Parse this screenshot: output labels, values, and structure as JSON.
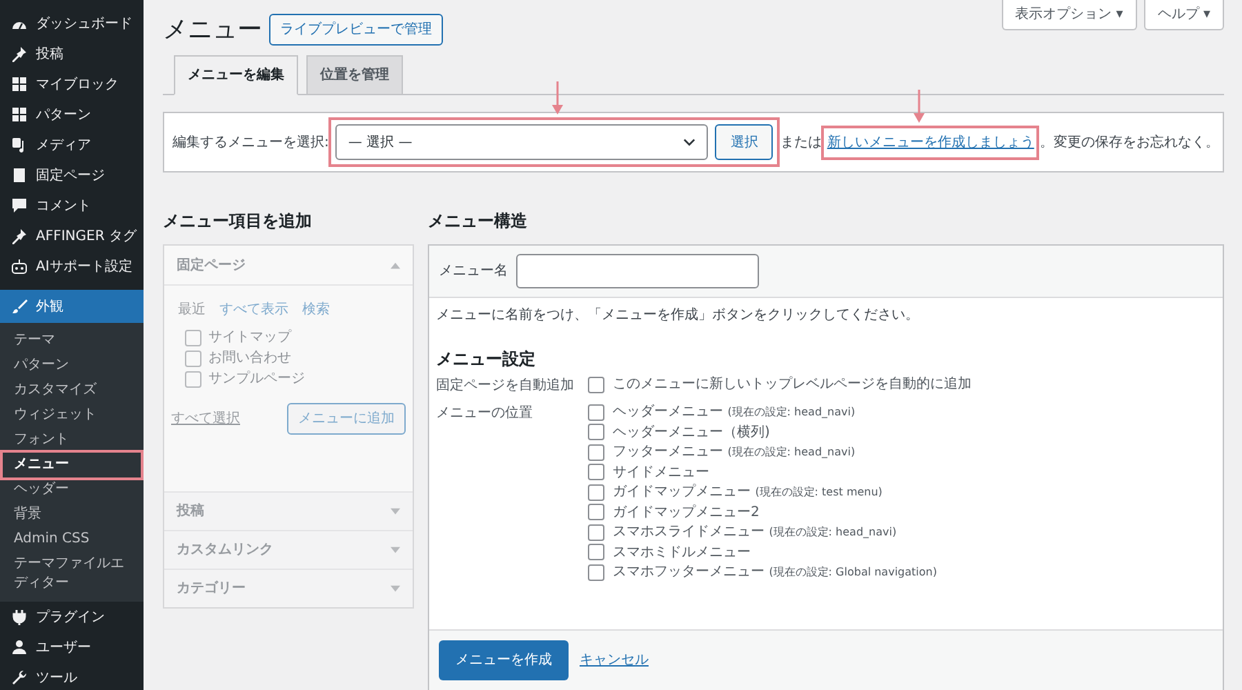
{
  "sidebar": {
    "items": [
      {
        "label": "ダッシュボード",
        "kind": "gauge",
        "current": false
      },
      {
        "label": "投稿",
        "kind": "pin",
        "current": false
      },
      {
        "label": "マイブロック",
        "kind": "grid",
        "current": false
      },
      {
        "label": "パターン",
        "kind": "grid",
        "current": false
      },
      {
        "label": "メディア",
        "kind": "media",
        "current": false
      },
      {
        "label": "固定ページ",
        "kind": "page",
        "current": false
      },
      {
        "label": "コメント",
        "kind": "comment",
        "current": false
      },
      {
        "label": "AFFINGER タグ",
        "kind": "pin",
        "current": false
      },
      {
        "label": "AIサポート設定",
        "kind": "robot",
        "current": false
      },
      {
        "label": "外観",
        "kind": "brush",
        "current": true,
        "children": [
          {
            "label": "テーマ",
            "selected": false,
            "highlighted": false
          },
          {
            "label": "パターン",
            "selected": false,
            "highlighted": false
          },
          {
            "label": "カスタマイズ",
            "selected": false,
            "highlighted": false
          },
          {
            "label": "ウィジェット",
            "selected": false,
            "highlighted": false
          },
          {
            "label": "フォント",
            "selected": false,
            "highlighted": false
          },
          {
            "label": "メニュー",
            "selected": true,
            "highlighted": true
          },
          {
            "label": "ヘッダー",
            "selected": false,
            "highlighted": false
          },
          {
            "label": "背景",
            "selected": false,
            "highlighted": false
          },
          {
            "label": "Admin CSS",
            "selected": false,
            "highlighted": false
          },
          {
            "label": "テーマファイルエディター",
            "selected": false,
            "highlighted": false
          }
        ]
      },
      {
        "label": "プラグイン",
        "kind": "plug",
        "current": false
      },
      {
        "label": "ユーザー",
        "kind": "user",
        "current": false
      },
      {
        "label": "ツール",
        "kind": "wrench",
        "current": false
      }
    ]
  },
  "header": {
    "title": "メニュー",
    "live_preview_button": "ライブプレビューで管理",
    "screen_options": "表示オプション ▾",
    "help": "ヘルプ ▾"
  },
  "tabs": [
    {
      "label": "メニューを編集",
      "selected": true
    },
    {
      "label": "位置を管理",
      "selected": false
    }
  ],
  "select_bar": {
    "label": "編集するメニューを選択:",
    "value": "— 選択 —",
    "button": "選択",
    "highlighted": true,
    "or_text": "または",
    "create_link": "新しいメニューを作成しましょう",
    "link_highlighted": true,
    "tail": "。変更の保存をお忘れなく。"
  },
  "add_items": {
    "heading": "メニュー項目を追加",
    "disabled": true,
    "sections": [
      {
        "title": "固定ページ",
        "expanded": true,
        "tabs": [
          {
            "label": "最近",
            "selected": true
          },
          {
            "label": "すべて表示",
            "selected": false
          },
          {
            "label": "検索",
            "selected": false
          }
        ],
        "pages": [
          {
            "label": "サイトマップ",
            "checked": false
          },
          {
            "label": "お問い合わせ",
            "checked": false
          },
          {
            "label": "サンプルページ",
            "checked": false
          }
        ],
        "select_all": "すべて選択",
        "add_button": "メニューに追加"
      },
      {
        "title": "投稿",
        "expanded": false
      },
      {
        "title": "カスタムリンク",
        "expanded": false
      },
      {
        "title": "カテゴリー",
        "expanded": false
      }
    ]
  },
  "structure": {
    "heading": "メニュー構造",
    "name_label": "メニュー名",
    "instruction": "メニューに名前をつけ、「メニューを作成」ボタンをクリックしてください。",
    "settings_heading": "メニュー設定",
    "auto_add": {
      "label": "固定ページを自動追加",
      "option": "このメニューに新しいトップレベルページを自動的に追加",
      "checked": false
    },
    "locations": {
      "label": "メニューの位置",
      "items": [
        {
          "name": "ヘッダーメニュー",
          "note": "(現在の設定: head_navi)",
          "checked": false
        },
        {
          "name": "ヘッダーメニュー（横列)",
          "checked": false
        },
        {
          "name": "フッターメニュー",
          "note": "(現在の設定: head_navi)",
          "checked": false
        },
        {
          "name": "サイドメニュー",
          "checked": false
        },
        {
          "name": "ガイドマップメニュー",
          "note": "(現在の設定: test menu)",
          "checked": false
        },
        {
          "name": "ガイドマップメニュー2",
          "checked": false
        },
        {
          "name": "スマホスライドメニュー",
          "note": "(現在の設定: head_navi)",
          "checked": false
        },
        {
          "name": "スマホミドルメニュー",
          "checked": false
        },
        {
          "name": "スマホフッターメニュー",
          "note": "(現在の設定: Global navigation)",
          "checked": false
        }
      ]
    },
    "create_button": "メニューを作成",
    "cancel_link": "キャンセル"
  }
}
